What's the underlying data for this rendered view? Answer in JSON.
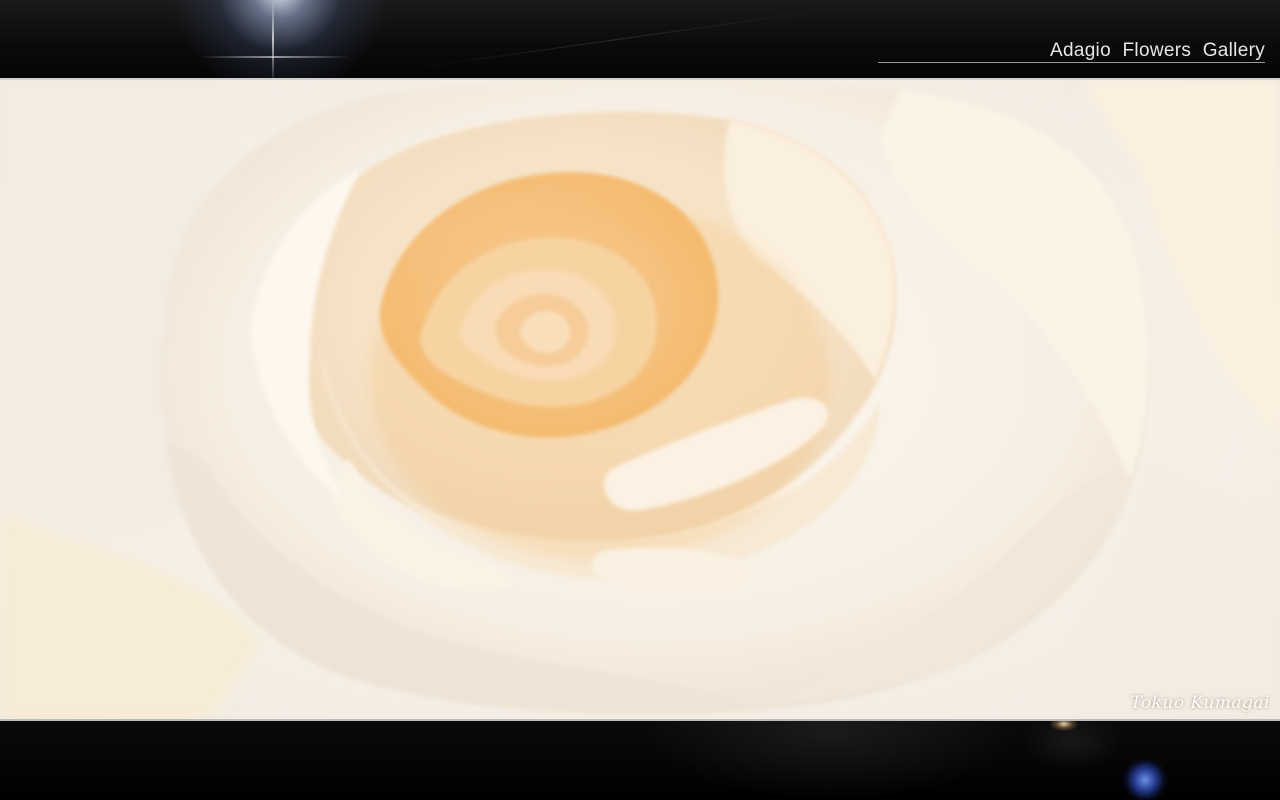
{
  "header": {
    "title": "Adagio  Flowers  Gallery"
  },
  "photo": {
    "subject": "cream-rose",
    "signature": "Tokuo Kumagai"
  },
  "colors": {
    "band": "#000000",
    "petal_light": "#fbf6ee",
    "petal_mid": "#f3e3cc",
    "petal_shadow": "#e7cfa8",
    "petal_core": "#f4b86a"
  }
}
